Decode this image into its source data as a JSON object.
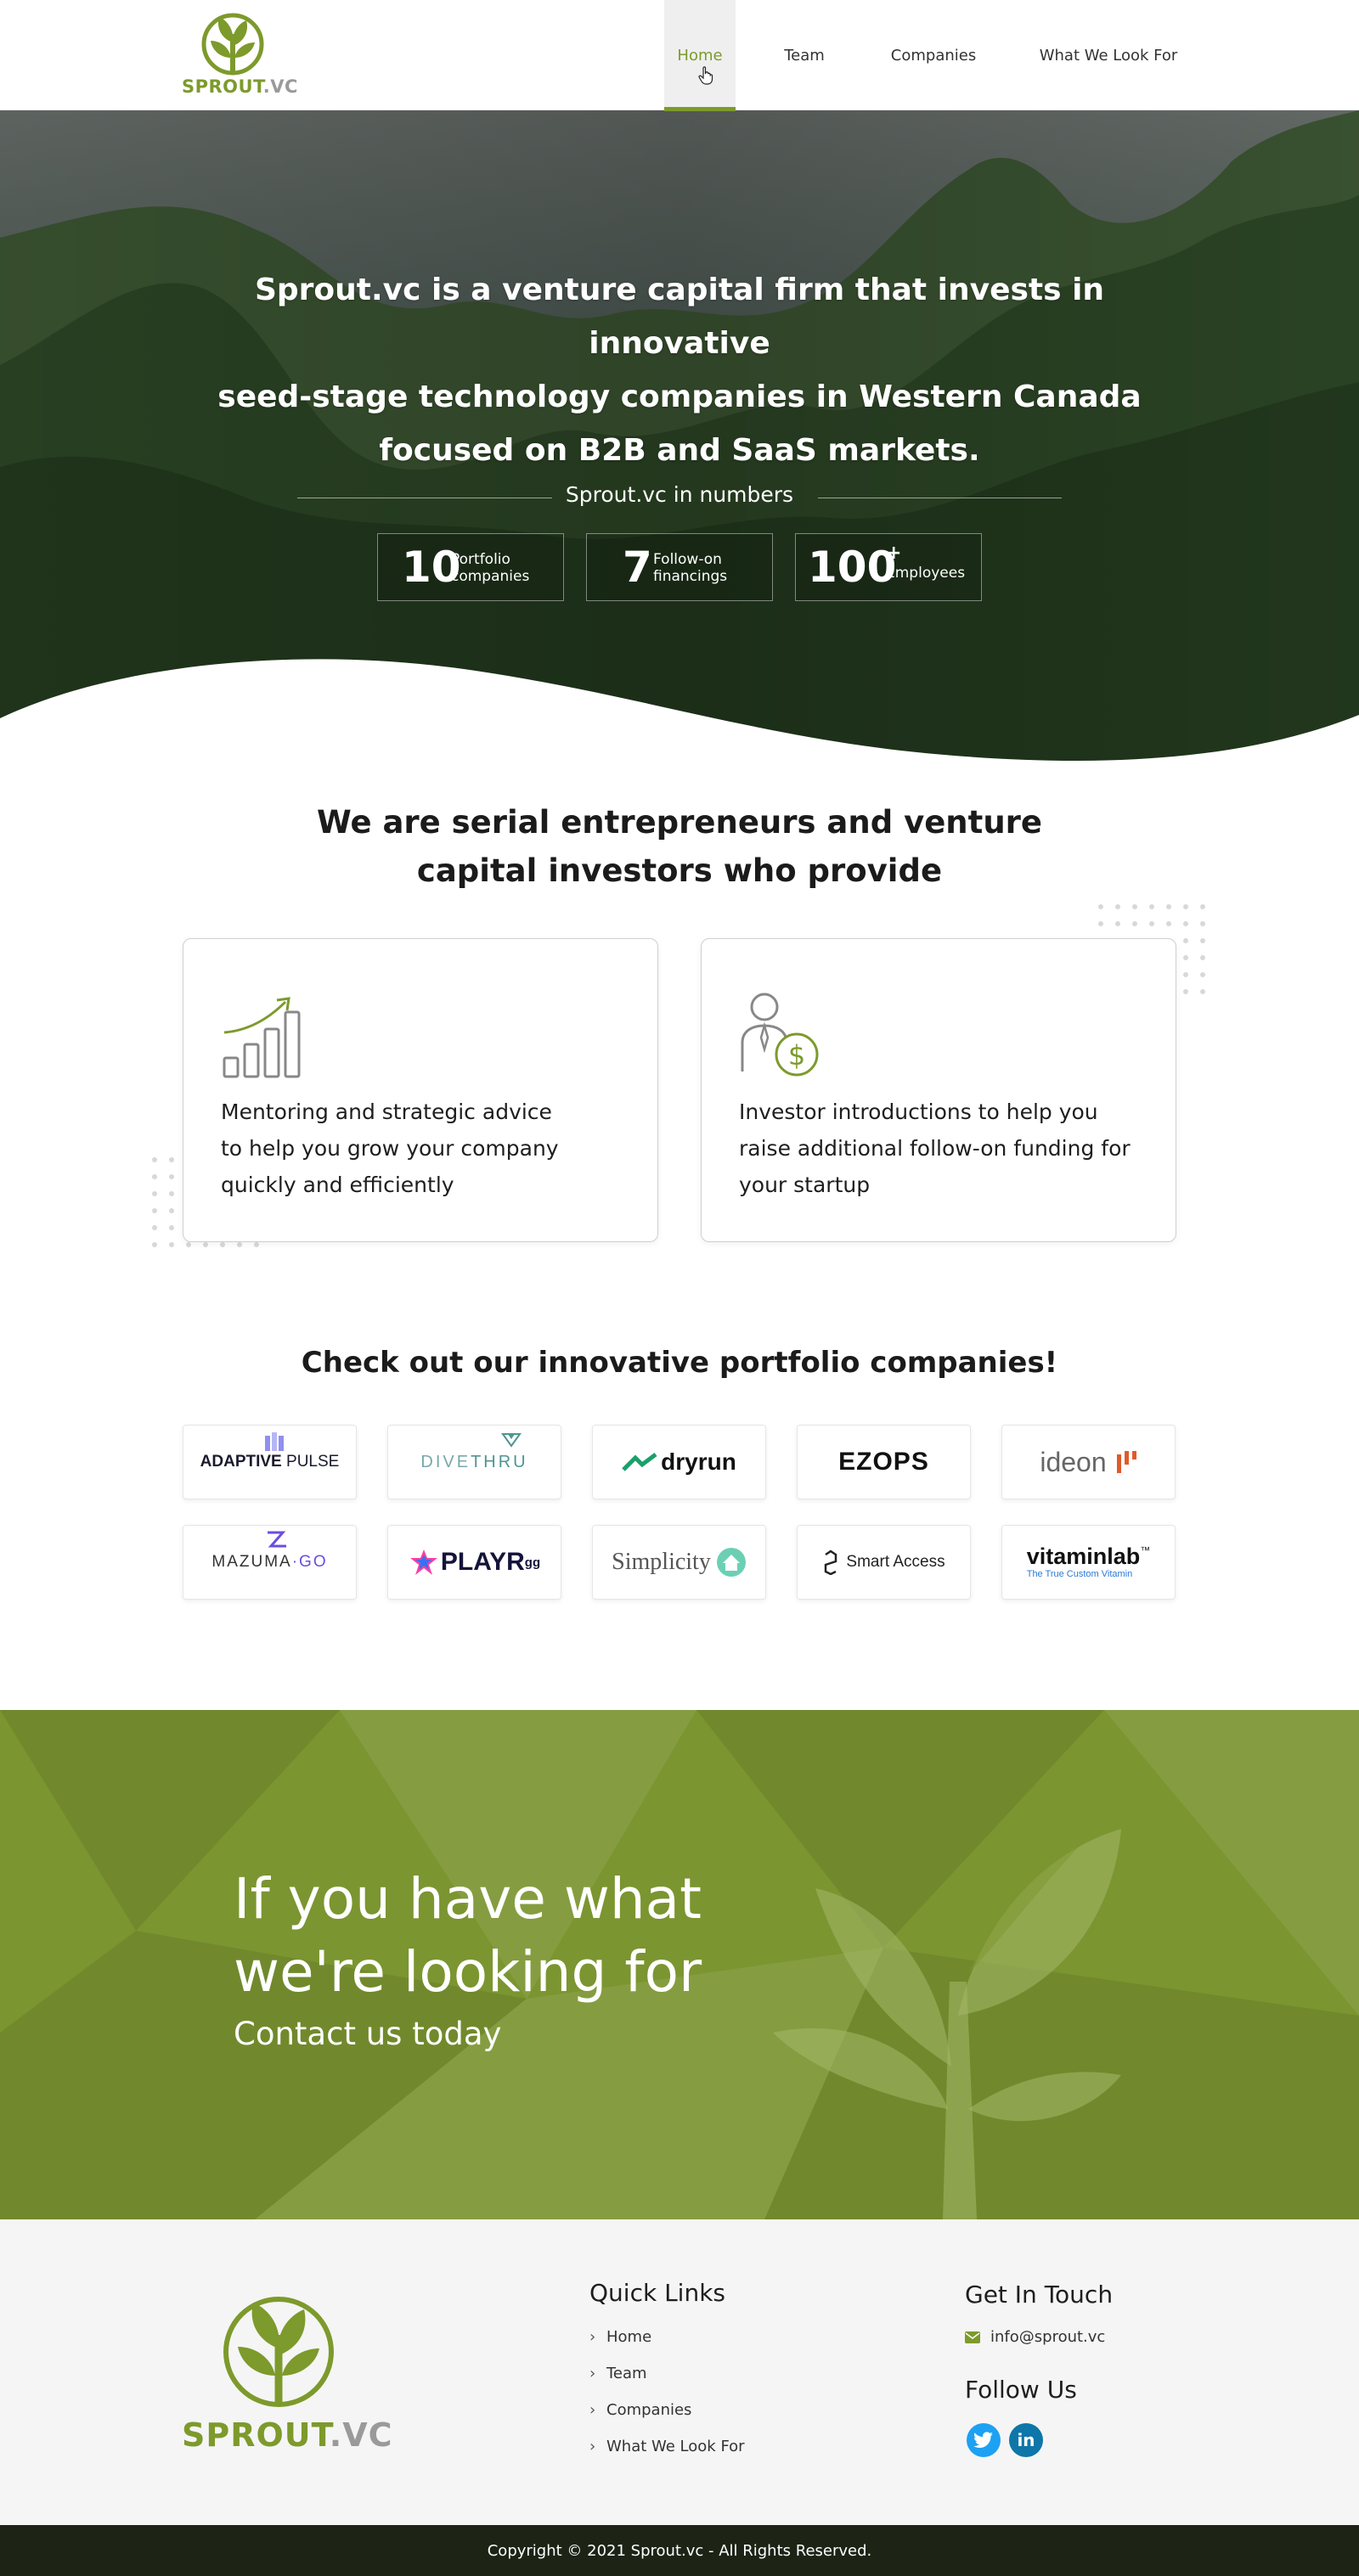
{
  "brand": {
    "name_green": "SPROUT",
    "name_gray": ".VC",
    "accent": "#7d9a2c"
  },
  "nav": {
    "items": [
      {
        "label": "Home",
        "active": true
      },
      {
        "label": "Team"
      },
      {
        "label": "Companies"
      },
      {
        "label": "What We Look For"
      }
    ]
  },
  "hero": {
    "title_line1": "Sprout.vc is a venture capital firm that invests in innovative",
    "title_line2": "seed-stage technology companies in Western Canada",
    "title_line3": "focused on B2B and SaaS markets.",
    "numbers_heading": "Sprout.vc in numbers",
    "stats": [
      {
        "value": "10",
        "label_line1": "Portfolio",
        "label_line2": "companies"
      },
      {
        "value": "7",
        "label_line1": "Follow-on",
        "label_line2": "financings"
      },
      {
        "value": "100",
        "suffix": "+",
        "label_line1": "Employees"
      }
    ]
  },
  "services": {
    "heading_line1": "We are serial entrepreneurs and venture",
    "heading_line2": "capital investors who provide",
    "cards": [
      {
        "icon": "growth-chart-icon",
        "line1": "Mentoring and strategic advice",
        "line2": "to help you grow your company",
        "line3": "quickly and efficiently"
      },
      {
        "icon": "investor-dollar-icon",
        "line1": "Investor introductions to help you",
        "line2": "raise additional follow-on funding for",
        "line3": "your startup"
      }
    ]
  },
  "portfolio": {
    "heading": "Check out our innovative portfolio companies!",
    "companies": [
      {
        "name_a": "ADAPTIVE",
        "name_b": "PULSE"
      },
      {
        "name_a": "DIVE",
        "name_b": "THRU"
      },
      {
        "name_a": "dryrun"
      },
      {
        "name_a": "EZOPS"
      },
      {
        "name_a": "ideon"
      },
      {
        "name_a": "MAZUMA",
        "name_b": "GO"
      },
      {
        "name_a": "PLAYR",
        "name_b": "gg"
      },
      {
        "name_a": "Simplicity"
      },
      {
        "name_a": "Smart Access"
      },
      {
        "name_a": "vitaminlab",
        "tm": "™",
        "tagline": "The True Custom Vitamin"
      }
    ]
  },
  "cta": {
    "line1": "If you have what",
    "line2": "we're looking for",
    "sub": "Contact us today",
    "bg_color": "#7b9530"
  },
  "footer": {
    "quick_links_heading": "Quick Links",
    "links": [
      "Home",
      "Team",
      "Companies",
      "What We Look For"
    ],
    "contact_heading": "Get In Touch",
    "email": "info@sprout.vc",
    "follow_heading": "Follow Us",
    "social": [
      "twitter-icon",
      "linkedin-icon"
    ],
    "copyright": "Copyright © 2021 Sprout.vc - All Rights Reserved."
  }
}
